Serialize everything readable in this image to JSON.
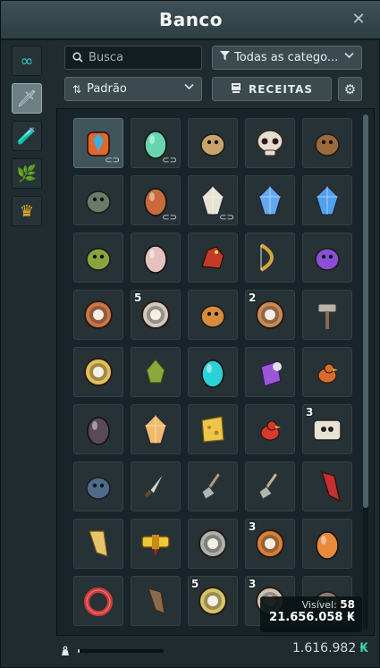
{
  "window": {
    "title": "Banco"
  },
  "sidebar": {
    "tabs": [
      {
        "name": "all",
        "icon": "infinity-icon",
        "glyph": "∞",
        "color": "#35c9c9",
        "active": false
      },
      {
        "name": "equipment",
        "icon": "sword-icon",
        "glyph": "🗡",
        "color": "#c9d9d8",
        "active": true
      },
      {
        "name": "consumables",
        "icon": "potion-icon",
        "glyph": "🧪",
        "color": "#c36ad6",
        "active": false
      },
      {
        "name": "resources",
        "icon": "leaf-icon",
        "glyph": "🌿",
        "color": "#8fd14f",
        "active": false
      },
      {
        "name": "quest",
        "icon": "crown-icon",
        "glyph": "♛",
        "color": "#f0b426",
        "active": false
      }
    ]
  },
  "toolbar": {
    "search_placeholder": "Busca",
    "category_label": "Todas as catego...",
    "sort_label": "Padrão",
    "recipes_label": "RECEITAS"
  },
  "grid": {
    "items": [
      {
        "icon": "chest-icon",
        "color": "#e0672c",
        "qty": "",
        "linked": true,
        "highlighted": true
      },
      {
        "icon": "egg-icon",
        "color": "#67d6b0",
        "qty": "",
        "linked": true
      },
      {
        "icon": "creature-icon",
        "color": "#caa36a",
        "qty": "",
        "linked": false
      },
      {
        "icon": "skull-icon",
        "color": "#e6ded3",
        "qty": "",
        "linked": false
      },
      {
        "icon": "monkey-icon",
        "color": "#9a6a3c",
        "qty": "",
        "linked": false
      },
      {
        "icon": "creature-icon",
        "color": "#6a7a68",
        "qty": "",
        "linked": false
      },
      {
        "icon": "egg-icon",
        "color": "#c96a3c",
        "qty": "",
        "linked": true
      },
      {
        "icon": "crystal-icon",
        "color": "#e7e2d4",
        "qty": "",
        "linked": true
      },
      {
        "icon": "crystal-icon",
        "color": "#63a9f0",
        "qty": "",
        "linked": false
      },
      {
        "icon": "crystal-icon",
        "color": "#4fa1ef",
        "qty": "",
        "linked": false
      },
      {
        "icon": "creature-icon",
        "color": "#8aa33c",
        "qty": "",
        "linked": false
      },
      {
        "icon": "egg-icon",
        "color": "#e5c1c0",
        "qty": "",
        "linked": false
      },
      {
        "icon": "dragon-icon",
        "color": "#c23a26",
        "qty": "",
        "linked": false
      },
      {
        "icon": "bow-icon",
        "color": "#d8a638",
        "qty": "",
        "linked": false
      },
      {
        "icon": "creature-icon",
        "color": "#8a4fd6",
        "qty": "",
        "linked": false
      },
      {
        "icon": "coin-icon",
        "color": "#c9764a",
        "qty": "",
        "linked": false
      },
      {
        "icon": "skull-coin-icon",
        "color": "#cfcac2",
        "qty": "5",
        "linked": false
      },
      {
        "icon": "cat-icon",
        "color": "#d98b3c",
        "qty": "",
        "linked": false
      },
      {
        "icon": "mushroom-coin-icon",
        "color": "#c98a5a",
        "qty": "2",
        "linked": false
      },
      {
        "icon": "hammer-icon",
        "color": "#b9b3a8",
        "qty": "",
        "linked": false
      },
      {
        "icon": "paw-coin-icon",
        "color": "#e1c05a",
        "qty": "",
        "linked": false
      },
      {
        "icon": "plant-icon",
        "color": "#8aa83c",
        "qty": "",
        "linked": false
      },
      {
        "icon": "egg-icon",
        "color": "#2ad2d6",
        "qty": "",
        "linked": false
      },
      {
        "icon": "scroll-icon",
        "color": "#9c55d8",
        "qty": "",
        "linked": false
      },
      {
        "icon": "bird-icon",
        "color": "#d86b2c",
        "qty": "",
        "linked": false
      },
      {
        "icon": "egg-icon",
        "color": "#5a4a56",
        "qty": "",
        "linked": false
      },
      {
        "icon": "crystal-icon",
        "color": "#f1b96a",
        "qty": "",
        "linked": false
      },
      {
        "icon": "cheese-icon",
        "color": "#ecc54a",
        "qty": "",
        "linked": false
      },
      {
        "icon": "bird-icon",
        "color": "#d83a2a",
        "qty": "",
        "linked": false
      },
      {
        "icon": "skull-card-icon",
        "color": "#e8e2d6",
        "qty": "3",
        "linked": false
      },
      {
        "icon": "creature-icon",
        "color": "#4f6a8a",
        "qty": "",
        "linked": false
      },
      {
        "icon": "knife-icon",
        "color": "#cfd6d4",
        "qty": "",
        "linked": false
      },
      {
        "icon": "shovel-icon",
        "color": "#b09a78",
        "qty": "",
        "linked": false
      },
      {
        "icon": "shovel-icon",
        "color": "#c4b393",
        "qty": "",
        "linked": false
      },
      {
        "icon": "cape-icon",
        "color": "#c53030",
        "qty": "",
        "linked": false
      },
      {
        "icon": "ribbon-icon",
        "color": "#e8c56a",
        "qty": "",
        "linked": false
      },
      {
        "icon": "belt-icon",
        "color": "#efc83a",
        "qty": "",
        "linked": false
      },
      {
        "icon": "shield-coin-icon",
        "color": "#aab1af",
        "qty": "",
        "linked": false
      },
      {
        "icon": "wing-coin-icon",
        "color": "#d4823a",
        "qty": "3",
        "linked": false
      },
      {
        "icon": "egg-icon",
        "color": "#e98a3a",
        "qty": "",
        "linked": false
      },
      {
        "icon": "ring-icon",
        "color": "#d23a3a",
        "qty": "",
        "linked": false
      },
      {
        "icon": "root-icon",
        "color": "#8a6a4a",
        "qty": "",
        "linked": false
      },
      {
        "icon": "wing-coin-icon",
        "color": "#d6c46a",
        "qty": "5",
        "linked": false
      },
      {
        "icon": "shield-coin-icon",
        "color": "#c9c4b3",
        "qty": "3",
        "linked": false
      },
      {
        "icon": "creature-icon",
        "color": "#8a7a6a",
        "qty": "",
        "linked": false
      }
    ]
  },
  "status": {
    "visible_label": "Visível:",
    "visible_count": "58",
    "visible_kamas": "21.656.058",
    "kamas_symbol": "₭",
    "total_kamas": "1.616.982",
    "weight_fraction": 0.02
  }
}
